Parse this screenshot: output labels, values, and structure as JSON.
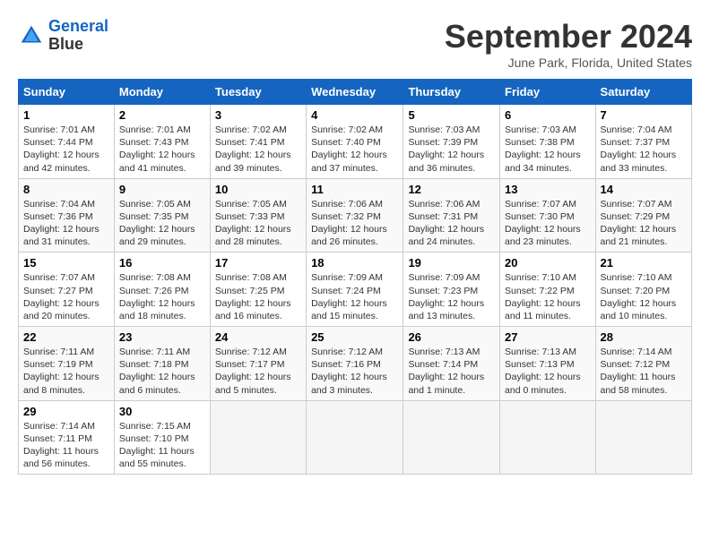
{
  "header": {
    "logo_line1": "General",
    "logo_line2": "Blue",
    "month": "September 2024",
    "location": "June Park, Florida, United States"
  },
  "weekdays": [
    "Sunday",
    "Monday",
    "Tuesday",
    "Wednesday",
    "Thursday",
    "Friday",
    "Saturday"
  ],
  "weeks": [
    [
      {
        "day": "1",
        "sunrise": "7:01 AM",
        "sunset": "7:44 PM",
        "daylight": "12 hours and 42 minutes."
      },
      {
        "day": "2",
        "sunrise": "7:01 AM",
        "sunset": "7:43 PM",
        "daylight": "12 hours and 41 minutes."
      },
      {
        "day": "3",
        "sunrise": "7:02 AM",
        "sunset": "7:41 PM",
        "daylight": "12 hours and 39 minutes."
      },
      {
        "day": "4",
        "sunrise": "7:02 AM",
        "sunset": "7:40 PM",
        "daylight": "12 hours and 37 minutes."
      },
      {
        "day": "5",
        "sunrise": "7:03 AM",
        "sunset": "7:39 PM",
        "daylight": "12 hours and 36 minutes."
      },
      {
        "day": "6",
        "sunrise": "7:03 AM",
        "sunset": "7:38 PM",
        "daylight": "12 hours and 34 minutes."
      },
      {
        "day": "7",
        "sunrise": "7:04 AM",
        "sunset": "7:37 PM",
        "daylight": "12 hours and 33 minutes."
      }
    ],
    [
      {
        "day": "8",
        "sunrise": "7:04 AM",
        "sunset": "7:36 PM",
        "daylight": "12 hours and 31 minutes."
      },
      {
        "day": "9",
        "sunrise": "7:05 AM",
        "sunset": "7:35 PM",
        "daylight": "12 hours and 29 minutes."
      },
      {
        "day": "10",
        "sunrise": "7:05 AM",
        "sunset": "7:33 PM",
        "daylight": "12 hours and 28 minutes."
      },
      {
        "day": "11",
        "sunrise": "7:06 AM",
        "sunset": "7:32 PM",
        "daylight": "12 hours and 26 minutes."
      },
      {
        "day": "12",
        "sunrise": "7:06 AM",
        "sunset": "7:31 PM",
        "daylight": "12 hours and 24 minutes."
      },
      {
        "day": "13",
        "sunrise": "7:07 AM",
        "sunset": "7:30 PM",
        "daylight": "12 hours and 23 minutes."
      },
      {
        "day": "14",
        "sunrise": "7:07 AM",
        "sunset": "7:29 PM",
        "daylight": "12 hours and 21 minutes."
      }
    ],
    [
      {
        "day": "15",
        "sunrise": "7:07 AM",
        "sunset": "7:27 PM",
        "daylight": "12 hours and 20 minutes."
      },
      {
        "day": "16",
        "sunrise": "7:08 AM",
        "sunset": "7:26 PM",
        "daylight": "12 hours and 18 minutes."
      },
      {
        "day": "17",
        "sunrise": "7:08 AM",
        "sunset": "7:25 PM",
        "daylight": "12 hours and 16 minutes."
      },
      {
        "day": "18",
        "sunrise": "7:09 AM",
        "sunset": "7:24 PM",
        "daylight": "12 hours and 15 minutes."
      },
      {
        "day": "19",
        "sunrise": "7:09 AM",
        "sunset": "7:23 PM",
        "daylight": "12 hours and 13 minutes."
      },
      {
        "day": "20",
        "sunrise": "7:10 AM",
        "sunset": "7:22 PM",
        "daylight": "12 hours and 11 minutes."
      },
      {
        "day": "21",
        "sunrise": "7:10 AM",
        "sunset": "7:20 PM",
        "daylight": "12 hours and 10 minutes."
      }
    ],
    [
      {
        "day": "22",
        "sunrise": "7:11 AM",
        "sunset": "7:19 PM",
        "daylight": "12 hours and 8 minutes."
      },
      {
        "day": "23",
        "sunrise": "7:11 AM",
        "sunset": "7:18 PM",
        "daylight": "12 hours and 6 minutes."
      },
      {
        "day": "24",
        "sunrise": "7:12 AM",
        "sunset": "7:17 PM",
        "daylight": "12 hours and 5 minutes."
      },
      {
        "day": "25",
        "sunrise": "7:12 AM",
        "sunset": "7:16 PM",
        "daylight": "12 hours and 3 minutes."
      },
      {
        "day": "26",
        "sunrise": "7:13 AM",
        "sunset": "7:14 PM",
        "daylight": "12 hours and 1 minute."
      },
      {
        "day": "27",
        "sunrise": "7:13 AM",
        "sunset": "7:13 PM",
        "daylight": "12 hours and 0 minutes."
      },
      {
        "day": "28",
        "sunrise": "7:14 AM",
        "sunset": "7:12 PM",
        "daylight": "11 hours and 58 minutes."
      }
    ],
    [
      {
        "day": "29",
        "sunrise": "7:14 AM",
        "sunset": "7:11 PM",
        "daylight": "11 hours and 56 minutes."
      },
      {
        "day": "30",
        "sunrise": "7:15 AM",
        "sunset": "7:10 PM",
        "daylight": "11 hours and 55 minutes."
      },
      null,
      null,
      null,
      null,
      null
    ]
  ]
}
